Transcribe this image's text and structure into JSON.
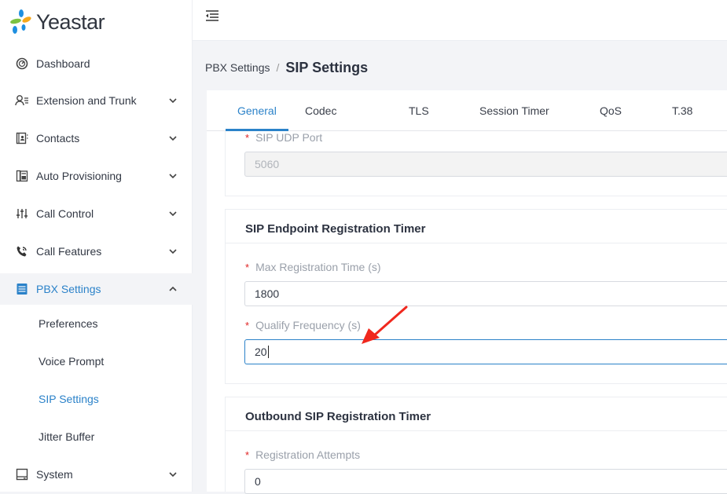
{
  "brand": {
    "name": "Yeastar"
  },
  "sidebar": {
    "items": [
      {
        "label": "Dashboard",
        "icon": "dashboard-icon",
        "expandable": false
      },
      {
        "label": "Extension and Trunk",
        "icon": "user-list-icon",
        "expandable": true
      },
      {
        "label": "Contacts",
        "icon": "contacts-icon",
        "expandable": true
      },
      {
        "label": "Auto Provisioning",
        "icon": "provisioning-icon",
        "expandable": true
      },
      {
        "label": "Call Control",
        "icon": "sliders-icon",
        "expandable": true
      },
      {
        "label": "Call Features",
        "icon": "phone-icon",
        "expandable": true
      },
      {
        "label": "PBX Settings",
        "icon": "server-icon",
        "expandable": true,
        "expanded": true,
        "active": true
      },
      {
        "label": "System",
        "icon": "monitor-icon",
        "expandable": true
      }
    ],
    "pbx_sub_items": [
      {
        "label": "Preferences"
      },
      {
        "label": "Voice Prompt"
      },
      {
        "label": "SIP Settings",
        "active": true
      },
      {
        "label": "Jitter Buffer"
      }
    ]
  },
  "breadcrumb": {
    "parent": "PBX Settings",
    "separator": "/",
    "current": "SIP Settings"
  },
  "tabs": [
    {
      "label": "General",
      "active": true
    },
    {
      "label": "Codec"
    },
    {
      "label": "TLS"
    },
    {
      "label": "Session Timer"
    },
    {
      "label": "QoS"
    },
    {
      "label": "T.38"
    }
  ],
  "sections": {
    "general": {
      "fields": [
        {
          "label": "SIP UDP Port",
          "value": "5060",
          "required": true,
          "disabled": true
        }
      ]
    },
    "endpoint_timer": {
      "title": "SIP Endpoint Registration Timer",
      "fields": [
        {
          "label": "Max Registration Time (s)",
          "value": "1800",
          "required": true
        },
        {
          "label": "Qualify Frequency (s)",
          "value": "20",
          "required": true,
          "focused": true
        }
      ]
    },
    "outbound_timer": {
      "title": "Outbound SIP Registration Timer",
      "fields": [
        {
          "label": "Registration Attempts",
          "value": "0",
          "required": true
        }
      ]
    }
  },
  "required_marker": "*",
  "colors": {
    "accent": "#2b82c9",
    "required": "#e02424",
    "annotation_arrow": "#f0281e"
  }
}
